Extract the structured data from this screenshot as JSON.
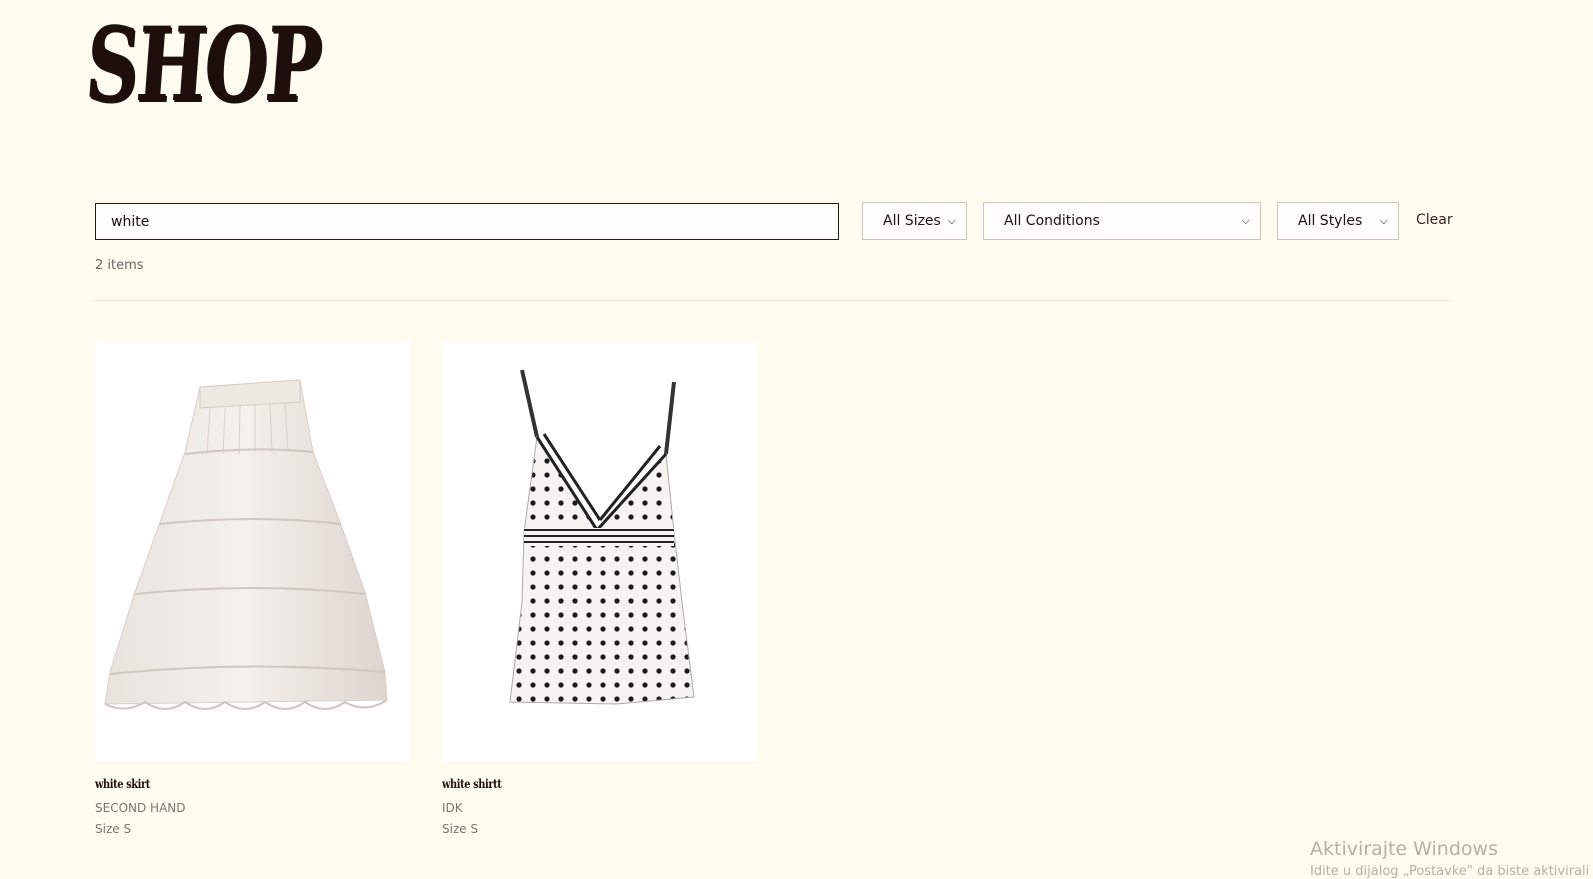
{
  "header": {
    "logo_text": "SHOP"
  },
  "filters": {
    "search_value": "white",
    "size_select": "All Sizes",
    "condition_select": "All Conditions",
    "style_select": "All Styles",
    "clear_label": "Clear"
  },
  "results": {
    "count_label": "2 items"
  },
  "products": [
    {
      "title": "white skirt",
      "condition": "SECOND HAND",
      "size": "Size S",
      "image_icon": "skirt-photo"
    },
    {
      "title": "white shirtt",
      "condition": "IDK",
      "size": "Size S",
      "image_icon": "polka-dot-top-photo"
    }
  ],
  "watermark": {
    "title": "Aktivirajte Windows",
    "subtitle": "Idite u dijalog „Postavke\" da biste aktivirali"
  },
  "colors": {
    "background": "#fefcef",
    "text": "#1a1110",
    "accent": "#3a1e1a"
  }
}
